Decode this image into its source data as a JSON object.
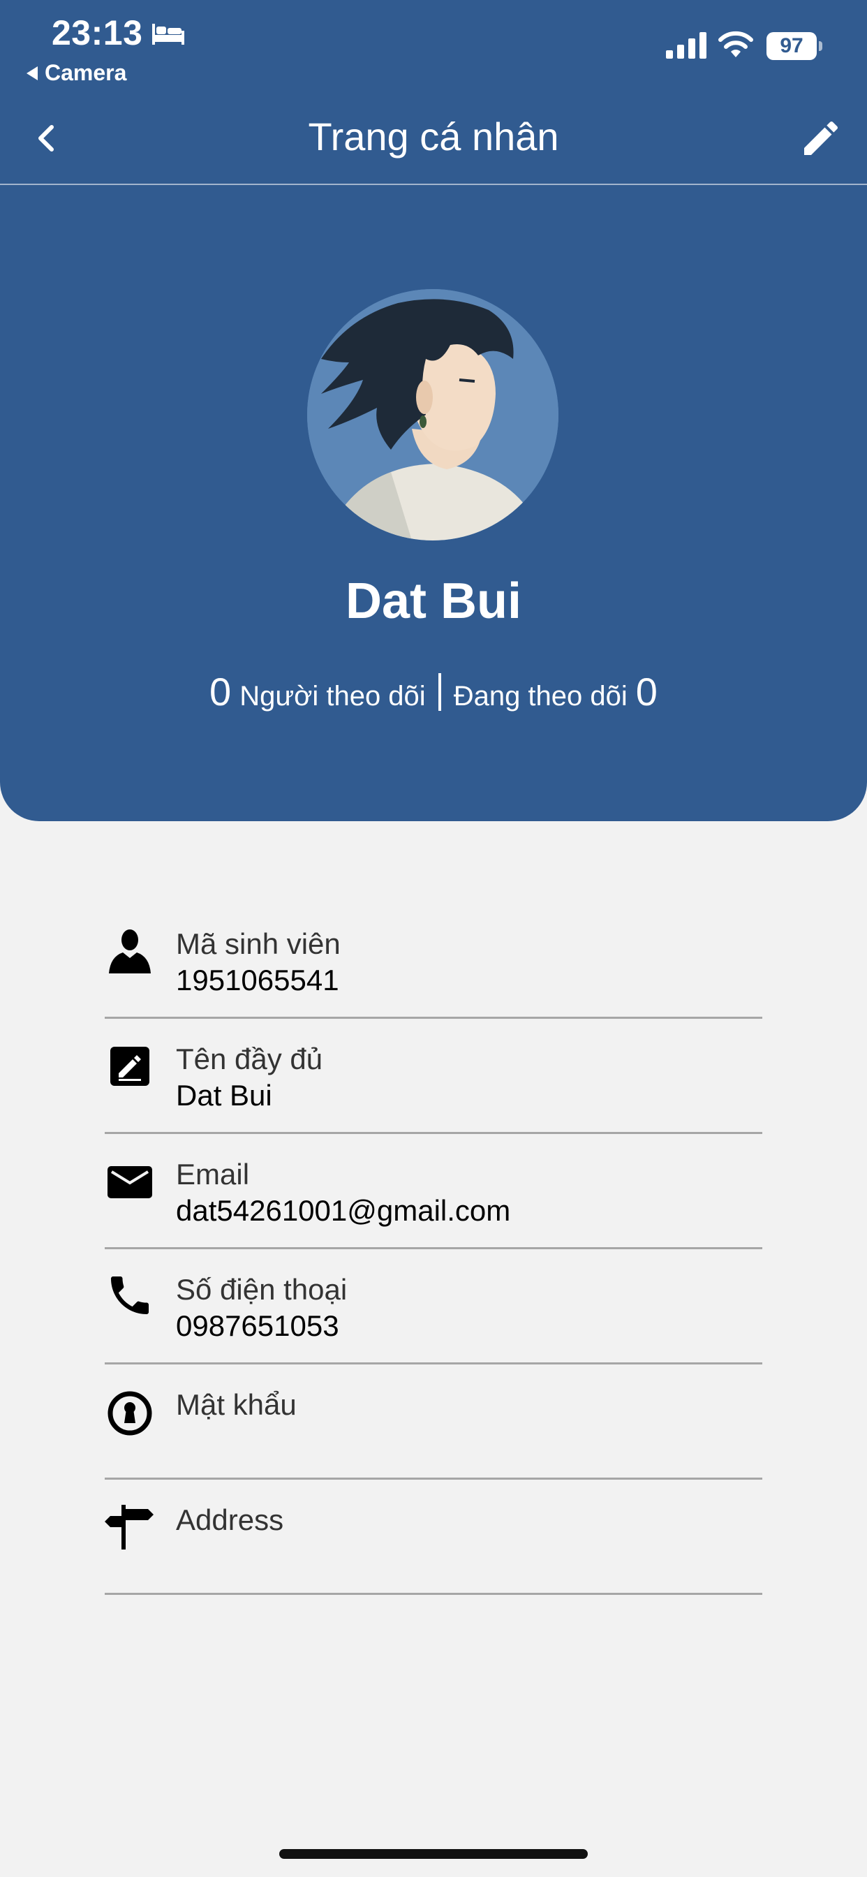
{
  "status_bar": {
    "time": "23:13",
    "back_app": "Camera",
    "battery": "97"
  },
  "nav": {
    "title": "Trang cá nhân"
  },
  "profile": {
    "name": "Dat Bui",
    "followers_count": "0",
    "followers_label": "Người theo dõi",
    "following_label": "Đang theo dõi",
    "following_count": "0"
  },
  "info": [
    {
      "icon": "person-icon",
      "label": "Mã sinh viên",
      "value": "1951065541"
    },
    {
      "icon": "edit-box-icon",
      "label": "Tên đầy đủ",
      "value": "Dat Bui"
    },
    {
      "icon": "mail-icon",
      "label": "Email",
      "value": "dat54261001@gmail.com"
    },
    {
      "icon": "phone-icon",
      "label": "Số điện thoại",
      "value": "0987651053"
    },
    {
      "icon": "keyhole-icon",
      "label": "Mật khẩu",
      "value": ""
    },
    {
      "icon": "signpost-icon",
      "label": "Address",
      "value": ""
    }
  ],
  "colors": {
    "header_blue": "#315b90",
    "background": "#f2f2f2",
    "divider": "#a6a6a6"
  }
}
